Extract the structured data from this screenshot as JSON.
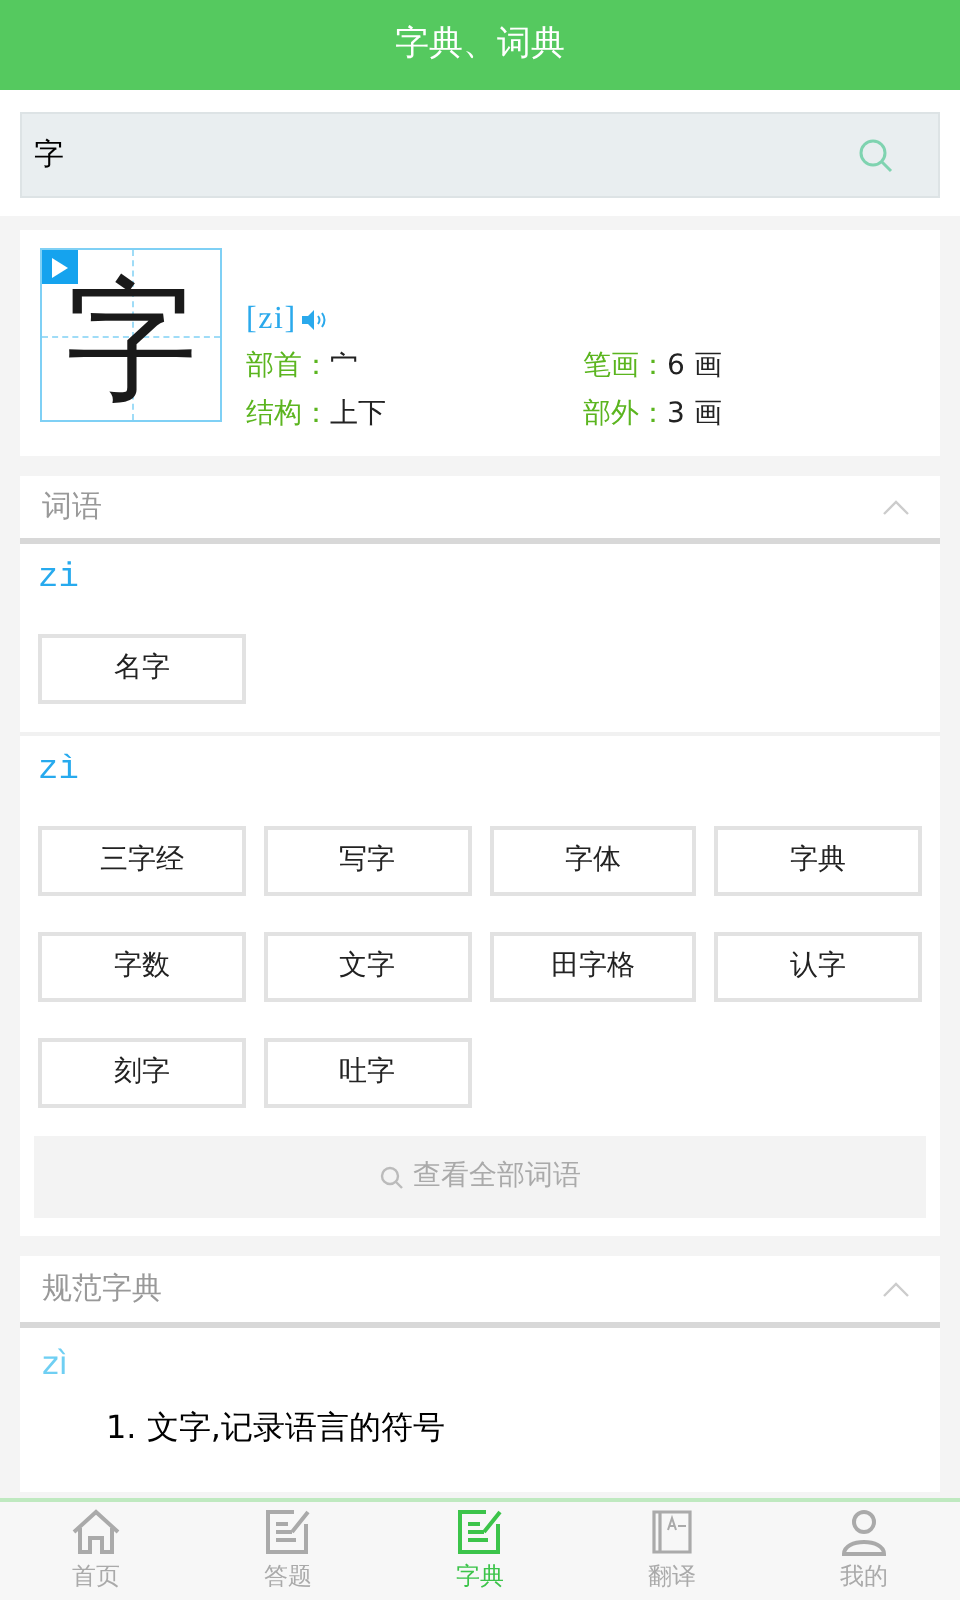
{
  "header": {
    "title": "字典、词典"
  },
  "search": {
    "value": "字"
  },
  "character": {
    "glyph": "字",
    "pinyin": "[zi]",
    "info": [
      {
        "label": "部首：",
        "value": "宀"
      },
      {
        "label": "笔画：",
        "value": "6 画"
      },
      {
        "label": "结构：",
        "value": "上下"
      },
      {
        "label": "部外：",
        "value": "3 画"
      }
    ]
  },
  "words": {
    "title": "词语",
    "expanded": true,
    "groups": [
      {
        "pinyin": "zi",
        "words": [
          "名字"
        ]
      },
      {
        "pinyin": "zì",
        "words": [
          "三字经",
          "写字",
          "字体",
          "字典",
          "字数",
          "文字",
          "田字格",
          "认字",
          "刻字",
          "吐字"
        ]
      }
    ],
    "more": "查看全部词语"
  },
  "dictionary": {
    "title": "规范字典",
    "expanded": true,
    "pinyin": "zì",
    "definitions": [
      "1. 文字,记录语言的符号"
    ]
  },
  "tabs": [
    {
      "label": "首页",
      "kind": "home",
      "selected": false
    },
    {
      "label": "答题",
      "kind": "quiz",
      "selected": false
    },
    {
      "label": "字典",
      "kind": "dict",
      "selected": true
    },
    {
      "label": "翻译",
      "kind": "translate",
      "selected": false
    },
    {
      "label": "我的",
      "kind": "me",
      "selected": false
    }
  ]
}
